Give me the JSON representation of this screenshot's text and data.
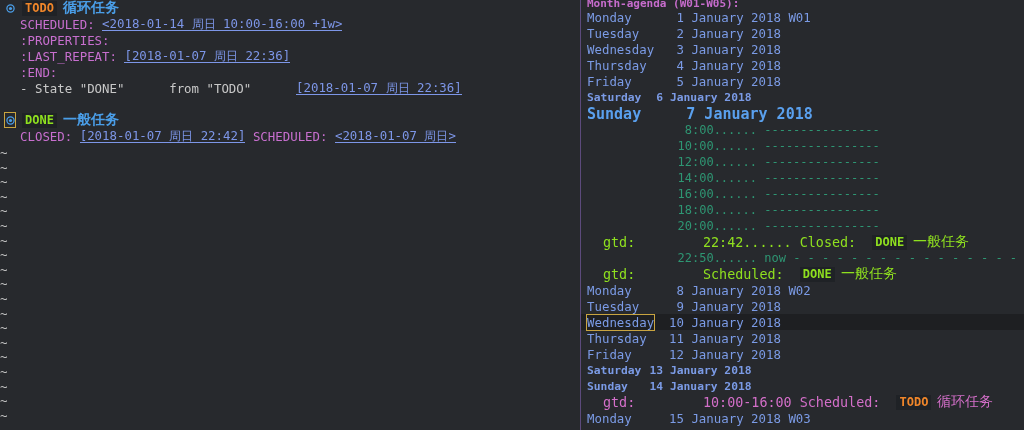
{
  "editor": {
    "entries": [
      {
        "keyword": {
          "text": "TODO",
          "color": "#f0862a"
        },
        "title": "循环任务",
        "cursor": false,
        "lines": [
          [
            {
              "kind": "label",
              "text": "SCHEDULED:"
            },
            {
              "kind": "date",
              "text": "<2018-01-14 周日 10:00-16:00 +1w>"
            }
          ],
          [
            {
              "kind": "label",
              "text": ":PROPERTIES:"
            }
          ],
          [
            {
              "kind": "label",
              "text": ":LAST_REPEAT:"
            },
            {
              "kind": "date",
              "text": "[2018-01-07 周日 22:36]"
            }
          ],
          [
            {
              "kind": "label",
              "text": ":END:"
            }
          ],
          [
            {
              "kind": "text",
              "text": "- State \"DONE\""
            },
            {
              "kind": "text",
              "text": "from \"TODO\""
            },
            {
              "kind": "date",
              "text": "[2018-01-07 周日 22:36]"
            }
          ]
        ]
      },
      {
        "keyword": {
          "text": "DONE",
          "color": "#8fe01f"
        },
        "title": "一般任务",
        "cursor": true,
        "lines": [
          [
            {
              "kind": "label",
              "text": "CLOSED:"
            },
            {
              "kind": "date",
              "text": "[2018-01-07 周日 22:42]"
            },
            {
              "kind": "label",
              "text": "SCHEDULED:"
            },
            {
              "kind": "date",
              "text": "<2018-01-07 周日>"
            }
          ]
        ]
      }
    ],
    "filler_lines": [
      "~",
      "~",
      "~",
      "~",
      "~",
      "~",
      "~",
      "~",
      "~",
      "~",
      "~",
      "~",
      "~",
      "~",
      "~",
      "~",
      "~",
      "~",
      "~"
    ]
  },
  "agenda": {
    "header": "Month-agenda (W01-W05):",
    "rows": [
      {
        "kind": "weekday",
        "weekday": "Monday",
        "day": "1",
        "month": "January 2018",
        "week": "W01",
        "cursor": false
      },
      {
        "kind": "weekday",
        "weekday": "Tuesday",
        "day": "2",
        "month": "January 2018",
        "cursor": false
      },
      {
        "kind": "weekday",
        "weekday": "Wednesday",
        "day": "3",
        "month": "January 2018",
        "cursor": false
      },
      {
        "kind": "weekday",
        "weekday": "Thursday",
        "day": "4",
        "month": "January 2018",
        "cursor": false
      },
      {
        "kind": "weekday",
        "weekday": "Friday",
        "day": "5",
        "month": "January 2018",
        "cursor": false
      },
      {
        "kind": "weekend",
        "weekday": "Saturday",
        "day": "6",
        "month": "January 2018"
      },
      {
        "kind": "today",
        "weekday": "Sunday",
        "day": "7",
        "month": "January 2018"
      },
      {
        "kind": "slot",
        "time": "8:00......",
        "rule": "----------------"
      },
      {
        "kind": "slot",
        "time": "10:00......",
        "rule": "----------------"
      },
      {
        "kind": "slot",
        "time": "12:00......",
        "rule": "----------------"
      },
      {
        "kind": "slot",
        "time": "14:00......",
        "rule": "----------------"
      },
      {
        "kind": "slot",
        "time": "16:00......",
        "rule": "----------------"
      },
      {
        "kind": "slot",
        "time": "18:00......",
        "rule": "----------------"
      },
      {
        "kind": "slot",
        "time": "20:00......",
        "rule": "----------------"
      },
      {
        "kind": "item",
        "color": "#8fe01f",
        "category": "gtd:",
        "time": "22:42......",
        "label": "Closed:",
        "keyword": {
          "text": "DONE",
          "color": "#8fe01f"
        },
        "title": "一般任务"
      },
      {
        "kind": "now",
        "time": "22:50......",
        "label": "now",
        "rule": "- - - - - - - - - - - - - - - -"
      },
      {
        "kind": "item",
        "color": "#8fe01f",
        "category": "gtd:",
        "label": "Scheduled:",
        "keyword": {
          "text": "DONE",
          "color": "#8fe01f"
        },
        "title": "一般任务"
      },
      {
        "kind": "weekday",
        "weekday": "Monday",
        "day": "8",
        "month": "January 2018",
        "week": "W02",
        "cursor": false
      },
      {
        "kind": "weekday",
        "weekday": "Tuesday",
        "day": "9",
        "month": "January 2018",
        "cursor": false
      },
      {
        "kind": "weekday",
        "weekday": "Wednesday",
        "day": "10",
        "month": "January 2018",
        "cursor": true
      },
      {
        "kind": "weekday",
        "weekday": "Thursday",
        "day": "11",
        "month": "January 2018",
        "cursor": false
      },
      {
        "kind": "weekday",
        "weekday": "Friday",
        "day": "12",
        "month": "January 2018",
        "cursor": false
      },
      {
        "kind": "weekend",
        "weekday": "Saturday",
        "day": "13",
        "month": "January 2018"
      },
      {
        "kind": "weekend",
        "weekday": "Sunday",
        "day": "14",
        "month": "January 2018"
      },
      {
        "kind": "item",
        "color": "#d46fc9",
        "category": "gtd:",
        "time": "10:00-16:00",
        "label": "Scheduled:",
        "keyword": {
          "text": "TODO",
          "color": "#f0862a"
        },
        "title": "循环任务"
      },
      {
        "kind": "weekday",
        "weekday": "Monday",
        "day": "15",
        "month": "January 2018",
        "week": "W03",
        "cursor": false
      }
    ]
  }
}
